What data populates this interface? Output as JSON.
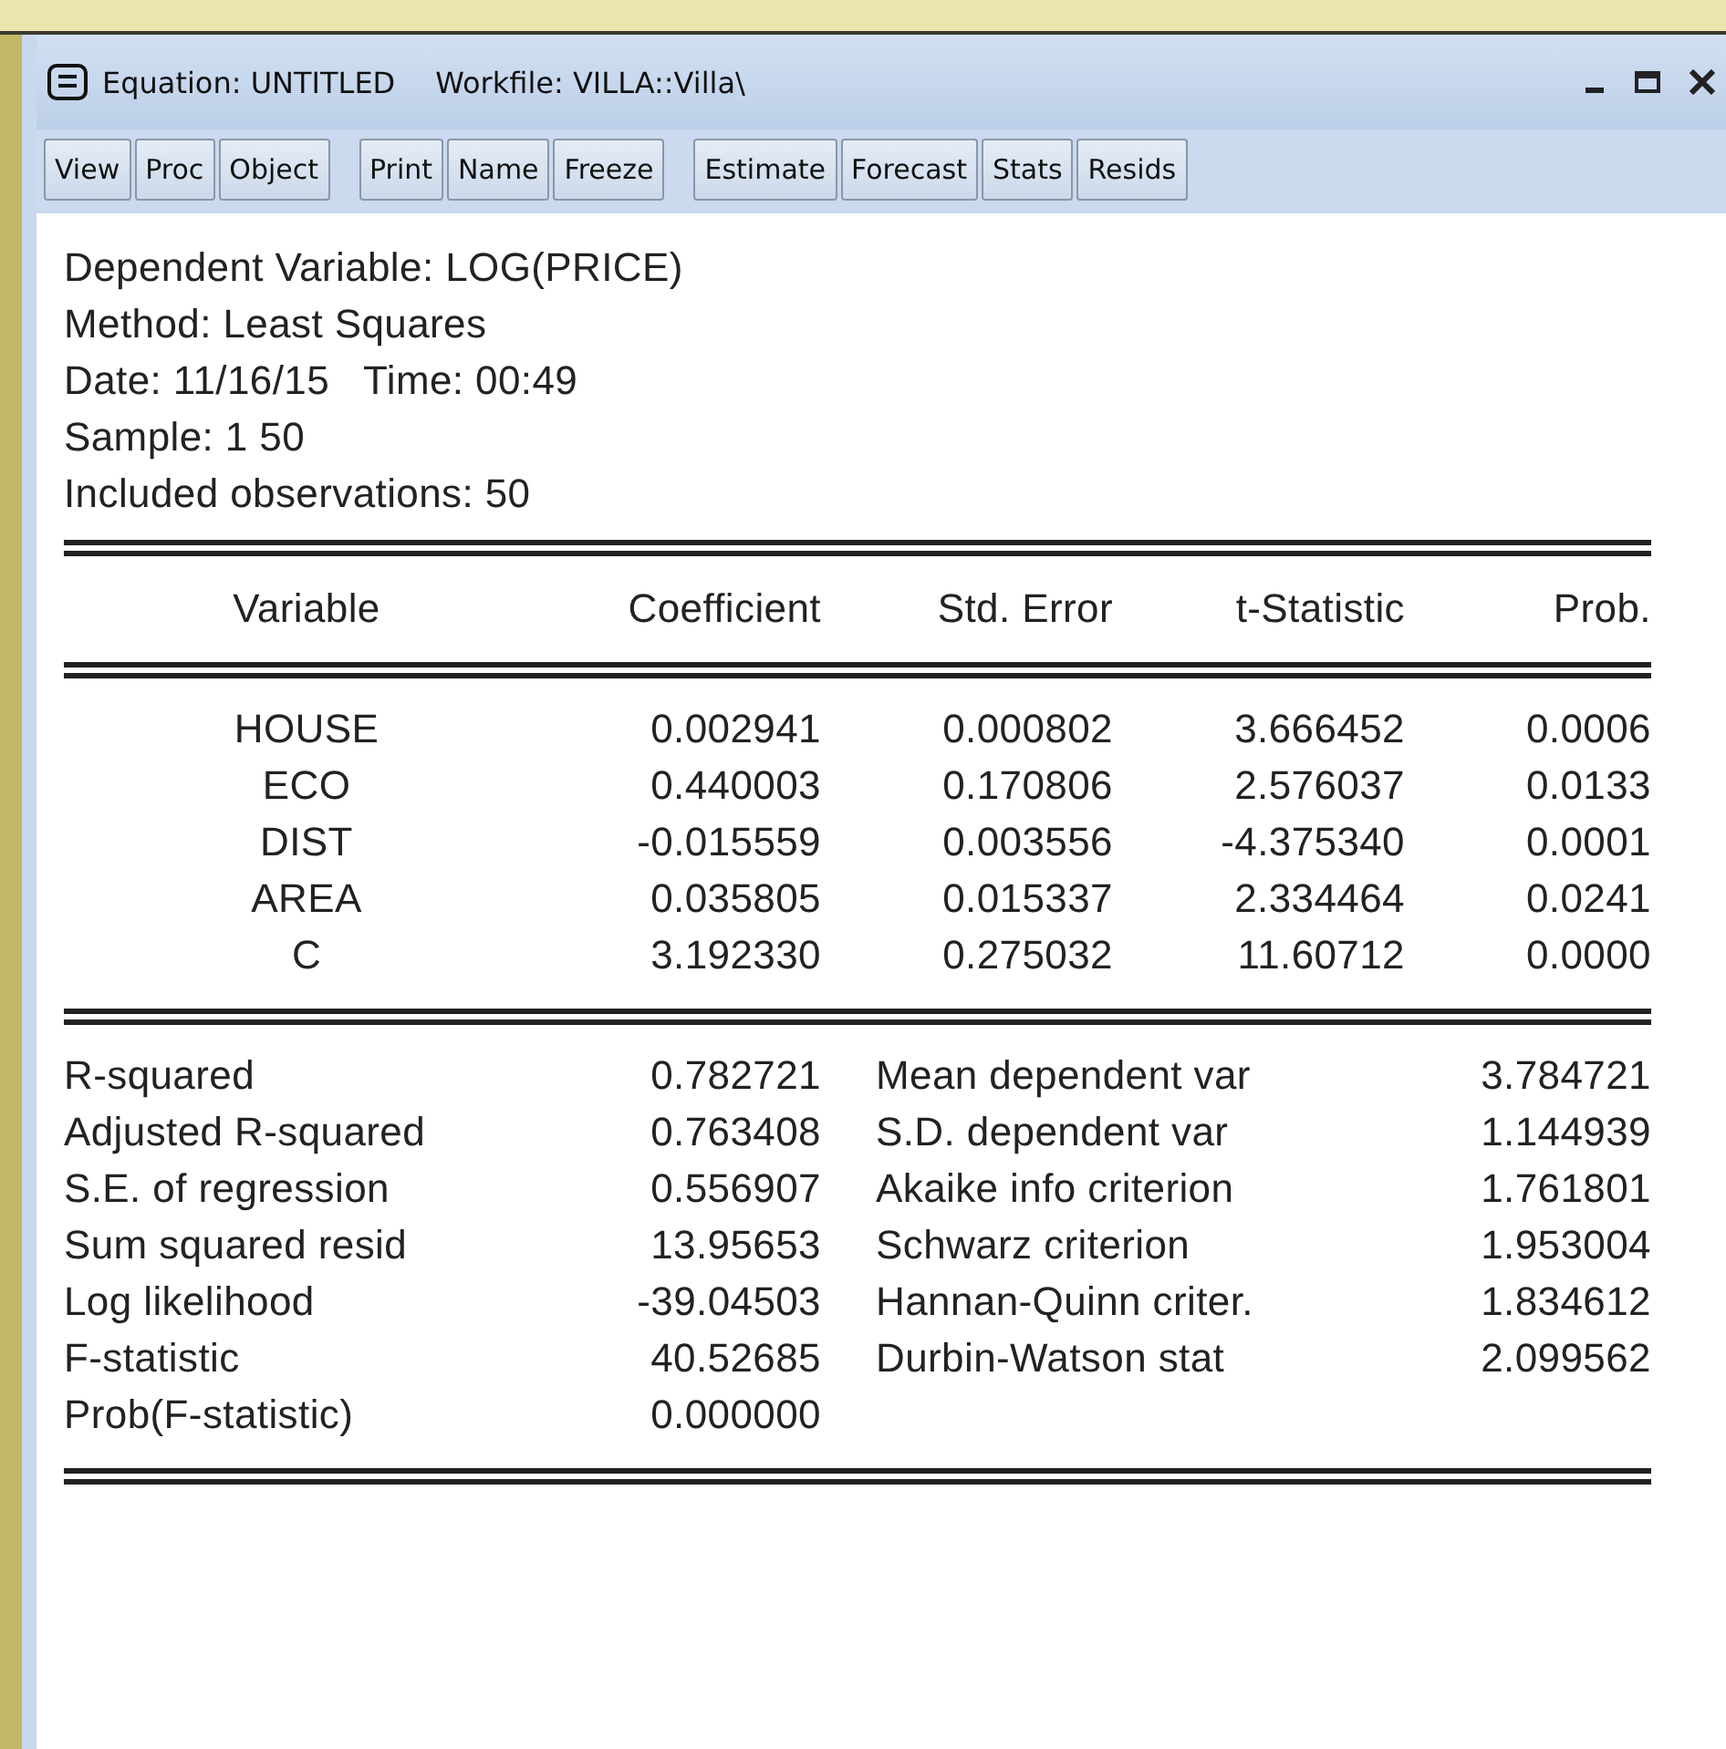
{
  "window": {
    "title": "Equation: UNTITLED",
    "workfile": "Workfile: VILLA::Villa\\"
  },
  "toolbar": [
    [
      "View",
      "Proc",
      "Object"
    ],
    [
      "Print",
      "Name",
      "Freeze"
    ],
    [
      "Estimate",
      "Forecast",
      "Stats",
      "Resids"
    ]
  ],
  "header_lines": [
    "Dependent Variable: LOG(PRICE)",
    "Method: Least Squares",
    "Date: 11/16/15   Time: 00:49",
    "Sample: 1 50",
    "Included observations: 50"
  ],
  "coefficients": {
    "columns": [
      "Variable",
      "Coefficient",
      "Std. Error",
      "t-Statistic",
      "Prob."
    ],
    "rows": [
      [
        "HOUSE",
        "0.002941",
        "0.000802",
        "3.666452",
        "0.0006"
      ],
      [
        "ECO",
        "0.440003",
        "0.170806",
        "2.576037",
        "0.0133"
      ],
      [
        "DIST",
        "-0.015559",
        "0.003556",
        "-4.375340",
        "0.0001"
      ],
      [
        "AREA",
        "0.035805",
        "0.015337",
        "2.334464",
        "0.0241"
      ],
      [
        "C",
        "3.192330",
        "0.275032",
        "11.60712",
        "0.0000"
      ]
    ]
  },
  "statistics": [
    {
      "label": "R-squared",
      "value": "0.782721",
      "label_2": "Mean dependent var",
      "value_2": "3.784721"
    },
    {
      "label": "Adjusted R-squared",
      "value": "0.763408",
      "label_2": "S.D. dependent var",
      "value_2": "1.144939"
    },
    {
      "label": "S.E. of regression",
      "value": "0.556907",
      "label_2": "Akaike info criterion",
      "value_2": "1.761801"
    },
    {
      "label": "Sum squared resid",
      "value": "13.95653",
      "label_2": "Schwarz criterion",
      "value_2": "1.953004"
    },
    {
      "label": "Log likelihood",
      "value": "-39.04503",
      "label_2": "Hannan-Quinn criter.",
      "value_2": "1.834612"
    },
    {
      "label": "F-statistic",
      "value": "40.52685",
      "label_2": "Durbin-Watson stat",
      "value_2": "2.099562"
    },
    {
      "label": "Prob(F-statistic)",
      "value": "0.000000"
    }
  ]
}
